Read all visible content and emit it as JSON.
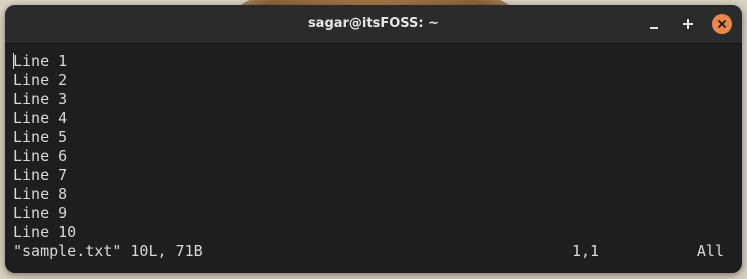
{
  "window": {
    "title": "sagar@itsFOSS: ~",
    "controls": {
      "minimize": "minimize-icon",
      "maximize": "plus-icon",
      "close": "close-icon",
      "close_color": "#e8884a"
    }
  },
  "terminal": {
    "lines": [
      "Line 1",
      "Line 2",
      "Line 3",
      "Line 4",
      "Line 5",
      "Line 6",
      "Line 7",
      "Line 8",
      "Line 9",
      "Line 10"
    ],
    "status": {
      "file_info": "\"sample.txt\" 10L, 71B",
      "cursor_position": "1,1",
      "scroll": "All"
    },
    "background": "#1e1e1e",
    "foreground": "#d8d8d8"
  }
}
